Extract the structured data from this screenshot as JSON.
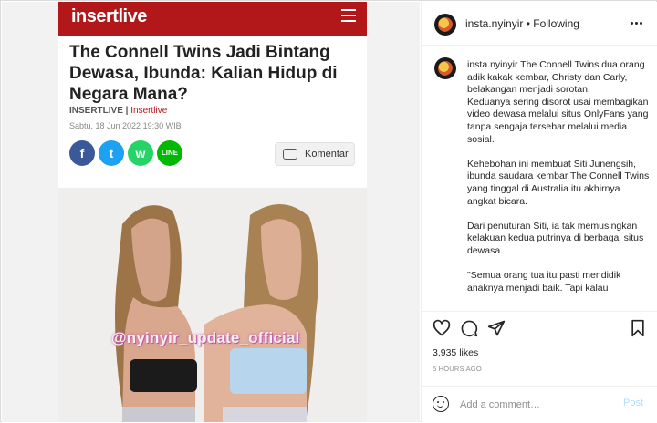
{
  "article": {
    "logo": "insertlive",
    "headline": "The Connell Twins Jadi Bintang Dewasa, Ibunda: Kalian Hidup di Negara Mana?",
    "byline_author": "INSERTLIVE",
    "byline_sep": " | ",
    "byline_source": "Insertlive",
    "dateline": "Sabtu, 18 Jun 2022 19:30 WIB",
    "share": {
      "facebook": "f",
      "twitter": "t",
      "whatsapp": "w",
      "line": "LINE"
    },
    "komentar_label": "Komentar",
    "watermark": "@nyinyir_update_official"
  },
  "post": {
    "username": "insta.nyinyir",
    "separator": "•",
    "follow_status": "Following",
    "caption_user": "insta.nyinyir",
    "caption_text": " The Connell Twins dua orang adik kakak kembar, Christy dan Carly, belakangan menjadi sorotan.\nKeduanya sering disorot usai membagikan video dewasa melalui situs OnlyFans yang tanpa sengaja tersebar melalui media sosial.\n\nKehebohan ini membuat Siti Junengsih, ibunda saudara kembar The Connell Twins yang tinggal di Australia itu akhirnya angkat bicara.\n\nDari penuturan Siti, ia tak memusingkan kelakuan kedua putrinya di berbagai situs dewasa.\n\n\"Semua orang tua itu pasti mendidik anaknya menjadi baik. Tapi kalau",
    "likes": "3,935 likes",
    "time_ago": "5 HOURS AGO",
    "comment_placeholder": "Add a comment…",
    "post_button": "Post"
  },
  "colors": {
    "brand_red": "#b2171a",
    "facebook": "#3b5998",
    "twitter": "#1da1f2",
    "whatsapp": "#25d366",
    "line": "#00b900",
    "post_button_disabled": "#b3dbff"
  },
  "icons": [
    "menu-icon",
    "comment-bubble-icon",
    "more-options-icon",
    "heart-icon",
    "comment-icon",
    "share-icon",
    "bookmark-icon",
    "emoji-icon"
  ]
}
